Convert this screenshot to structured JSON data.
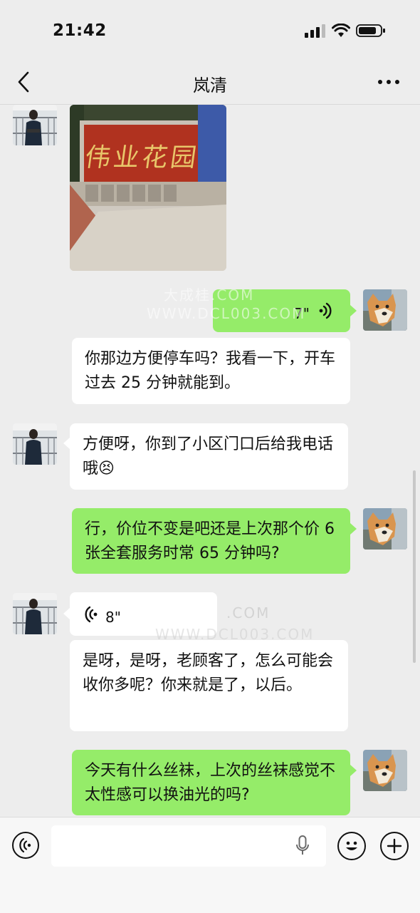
{
  "status_bar": {
    "time": "21:42"
  },
  "header": {
    "title": "岚清"
  },
  "messages": [
    {
      "side": "left",
      "type": "image",
      "image_sign_text": "伟业花园"
    },
    {
      "side": "right",
      "type": "voice",
      "duration": "7\""
    },
    {
      "side": "right",
      "type": "text",
      "text": "你那边方便停车吗？我看一下，开车过去 25 分钟就能到。"
    },
    {
      "side": "left",
      "type": "text",
      "text": "方便呀，你到了小区门口后给我电话哦😣"
    },
    {
      "side": "right",
      "type": "text",
      "text": "行，价位不变是吧还是上次那个价 6 张全套服务时常 65 分钟吗?"
    },
    {
      "side": "left",
      "type": "voice",
      "duration": "8\""
    },
    {
      "side": "left",
      "type": "text",
      "text": "是呀，是呀，老顾客了，怎么可能会收你多呢？你来就是了，以后。"
    },
    {
      "side": "right",
      "type": "text",
      "text": "今天有什么丝袜，上次的丝袜感觉不太性感可以换油光的吗?"
    }
  ],
  "watermarks": [
    "大成桂.COM",
    "WWW.DCL003.COM",
    ".COM",
    "WWW.DCL003.COM"
  ],
  "icons": {
    "back": "chevron-left-icon",
    "more": "more-dots-icon",
    "voice_toggle": "voice-mode-icon",
    "mic": "microphone-icon",
    "emoji": "emoji-icon",
    "plus": "plus-icon"
  },
  "colors": {
    "background": "#ededed",
    "bubble_mine": "#95ec69",
    "bubble_other": "#ffffff"
  }
}
